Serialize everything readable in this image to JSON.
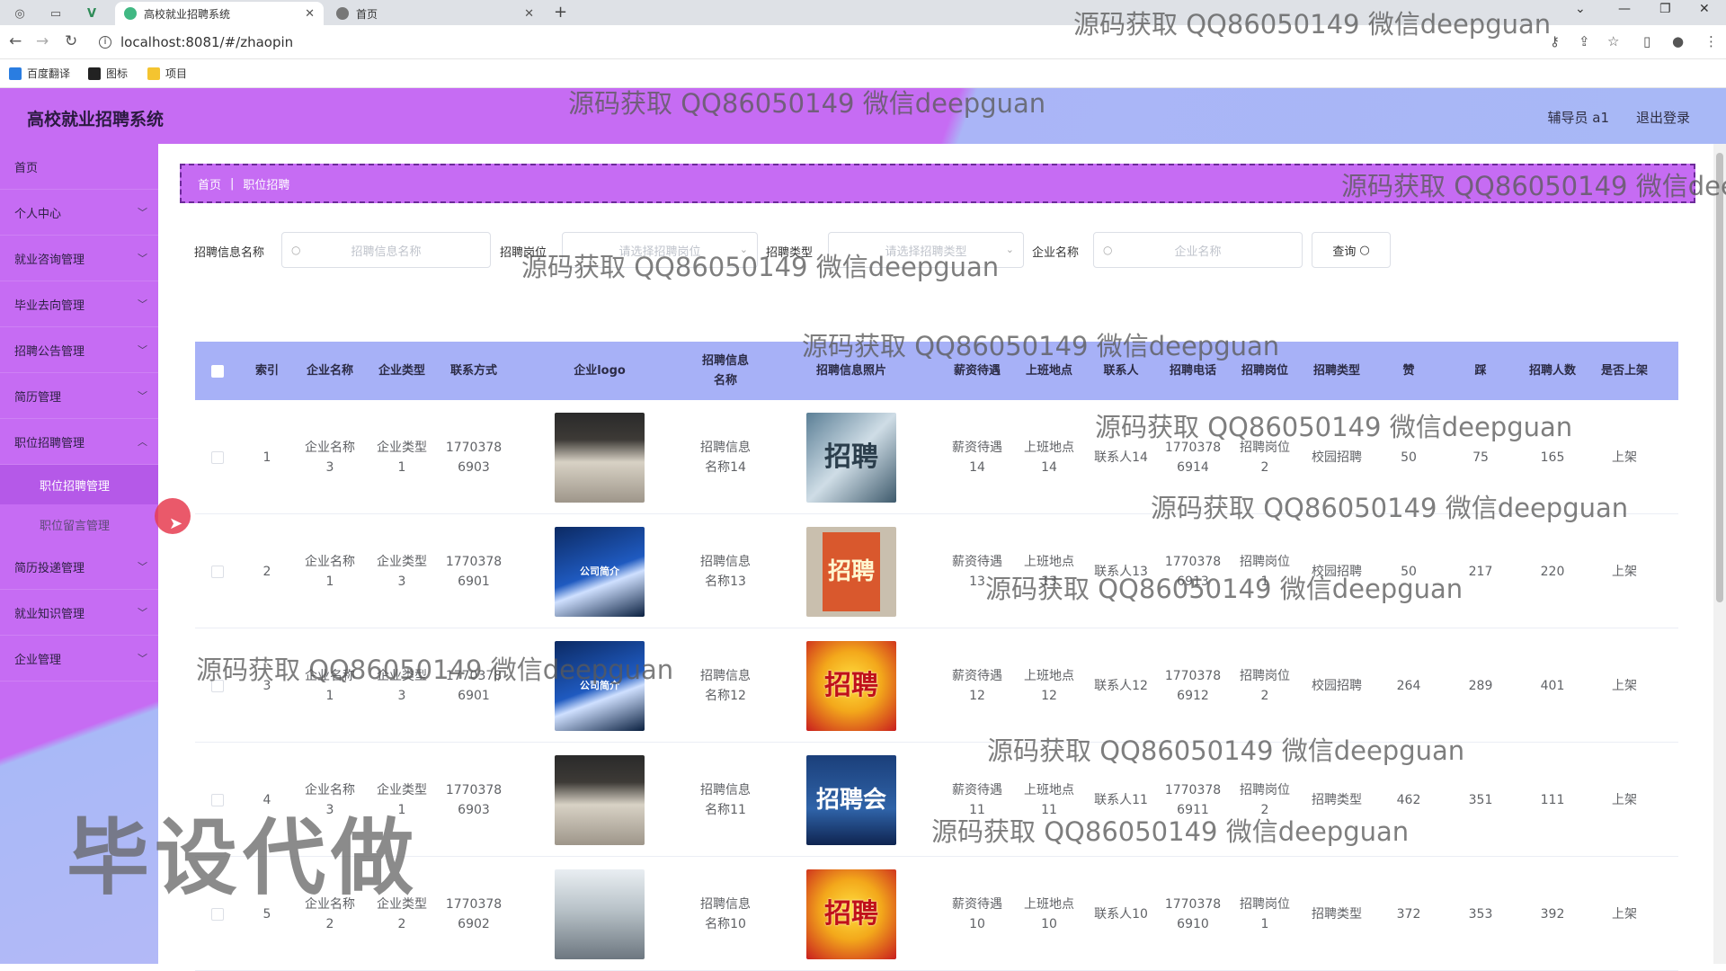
{
  "browser": {
    "tabs": [
      {
        "title": "高校就业招聘系统",
        "active": true
      },
      {
        "title": "首页",
        "active": false
      }
    ],
    "url": "localhost:8081/#/zhaopin",
    "bookmarks": [
      "百度翻译",
      "图标",
      "项目"
    ]
  },
  "header": {
    "title": "高校就业招聘系统",
    "user": "辅导员 a1",
    "logout": "退出登录"
  },
  "sidebar": {
    "items": [
      {
        "label": "首页",
        "has_children": false
      },
      {
        "label": "个人中心",
        "has_children": true
      },
      {
        "label": "就业咨询管理",
        "has_children": true
      },
      {
        "label": "毕业去向管理",
        "has_children": true
      },
      {
        "label": "招聘公告管理",
        "has_children": true
      },
      {
        "label": "简历管理",
        "has_children": true
      },
      {
        "label": "职位招聘管理",
        "has_children": true,
        "expanded": true,
        "children": [
          {
            "label": "职位招聘管理",
            "active": true
          },
          {
            "label": "职位留言管理",
            "active": false
          }
        ]
      },
      {
        "label": "简历投递管理",
        "has_children": true
      },
      {
        "label": "就业知识管理",
        "has_children": true
      },
      {
        "label": "企业管理",
        "has_children": true
      }
    ]
  },
  "breadcrumb": {
    "home": "首页",
    "current": "职位招聘"
  },
  "search": {
    "f1_label": "招聘信息名称",
    "f1_placeholder": "招聘信息名称",
    "f2_label": "招聘岗位",
    "f2_placeholder": "请选择招聘岗位",
    "f3_label": "招聘类型",
    "f3_placeholder": "请选择招聘类型",
    "f4_label": "企业名称",
    "f4_placeholder": "企业名称",
    "button": "查询"
  },
  "table": {
    "headers": {
      "index": "索引",
      "company": "企业名称",
      "company_type": "企业类型",
      "contact": "联系方式",
      "logo": "企业logo",
      "info_name": "招聘信息\n名称",
      "photo": "招聘信息照片",
      "salary": "薪资待遇",
      "location": "上班地点",
      "contact_person": "联系人",
      "phone": "招聘电话",
      "position": "招聘岗位",
      "type": "招聘类型",
      "likes": "赞",
      "dislikes": "踩",
      "headcount": "招聘人数",
      "listed": "是否上架"
    },
    "rows": [
      {
        "index": "1",
        "company": "企业名称\n3",
        "company_type": "企业类型\n1",
        "contact": "1770378\n6903",
        "logo": "lobby",
        "info_name": "招聘信息\n名称14",
        "photo": "招聘",
        "salary": "薪资待遇\n14",
        "location": "上班地点\n14",
        "contact_person": "联系人14",
        "phone": "1770378\n6914",
        "position": "招聘岗位\n2",
        "type": "校园招聘",
        "likes": "50",
        "dislikes": "75",
        "headcount": "165",
        "listed": "上架"
      },
      {
        "index": "2",
        "company": "企业名称\n1",
        "company_type": "企业类型\n3",
        "contact": "1770378\n6901",
        "logo": "公司简介",
        "info_name": "招聘信息\n名称13",
        "photo": "招聘",
        "salary": "薪资待遇\n13",
        "location": "上班地点\n13",
        "contact_person": "联系人13",
        "phone": "1770378\n6913",
        "position": "招聘岗位\n1",
        "type": "校园招聘",
        "likes": "50",
        "dislikes": "217",
        "headcount": "220",
        "listed": "上架"
      },
      {
        "index": "3",
        "company": "企业名称\n1",
        "company_type": "企业类型\n3",
        "contact": "1770378\n6901",
        "logo": "公司简介",
        "info_name": "招聘信息\n名称12",
        "photo": "招聘",
        "salary": "薪资待遇\n12",
        "location": "上班地点\n12",
        "contact_person": "联系人12",
        "phone": "1770378\n6912",
        "position": "招聘岗位\n2",
        "type": "校园招聘",
        "likes": "264",
        "dislikes": "289",
        "headcount": "401",
        "listed": "上架"
      },
      {
        "index": "4",
        "company": "企业名称\n3",
        "company_type": "企业类型\n1",
        "contact": "1770378\n6903",
        "logo": "lobby",
        "info_name": "招聘信息\n名称11",
        "photo": "招聘会",
        "salary": "薪资待遇\n11",
        "location": "上班地点\n11",
        "contact_person": "联系人11",
        "phone": "1770378\n6911",
        "position": "招聘岗位\n2",
        "type": "招聘类型",
        "likes": "462",
        "dislikes": "351",
        "headcount": "111",
        "listed": "上架"
      },
      {
        "index": "5",
        "company": "企业名称\n2",
        "company_type": "企业类型\n2",
        "contact": "1770378\n6902",
        "logo": "atrium",
        "info_name": "招聘信息\n名称10",
        "photo": "招聘",
        "salary": "薪资待遇\n10",
        "location": "上班地点\n10",
        "contact_person": "联系人10",
        "phone": "1770378\n6910",
        "position": "招聘岗位\n1",
        "type": "招聘类型",
        "likes": "372",
        "dislikes": "353",
        "headcount": "392",
        "listed": "上架"
      }
    ]
  },
  "watermark": {
    "text": "源码获取 QQ86050149 微信deepguan",
    "big": "毕设代做"
  },
  "colors": {
    "accent": "#c66cf3",
    "header_blue": "#a7b1f7",
    "active_sub": "#b559e8"
  }
}
